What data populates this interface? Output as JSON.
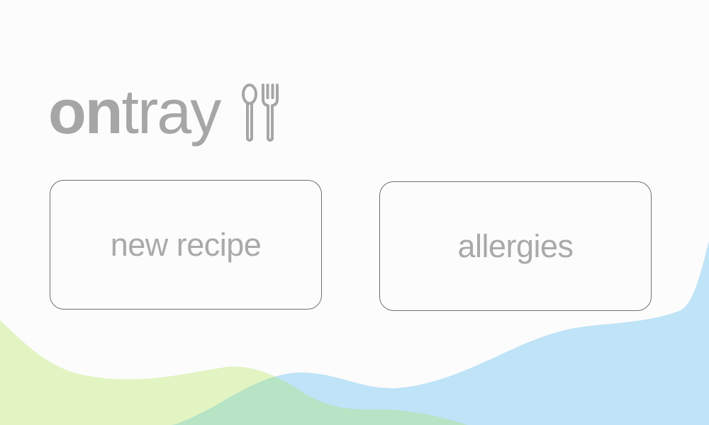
{
  "app": {
    "logo_bold": "on",
    "logo_light": "tray",
    "logo_icon": "cutlery-icon"
  },
  "menu": {
    "new_recipe_label": "new recipe",
    "allergies_label": "allergies"
  },
  "colors": {
    "background": "#fcfcfc",
    "text": "#a6a6a6",
    "tile_border": "#6f6f6f",
    "wave_green": "#e2f4c2",
    "wave_blue": "#bfe3f7",
    "wave_overlap": "#b6e4c4"
  }
}
